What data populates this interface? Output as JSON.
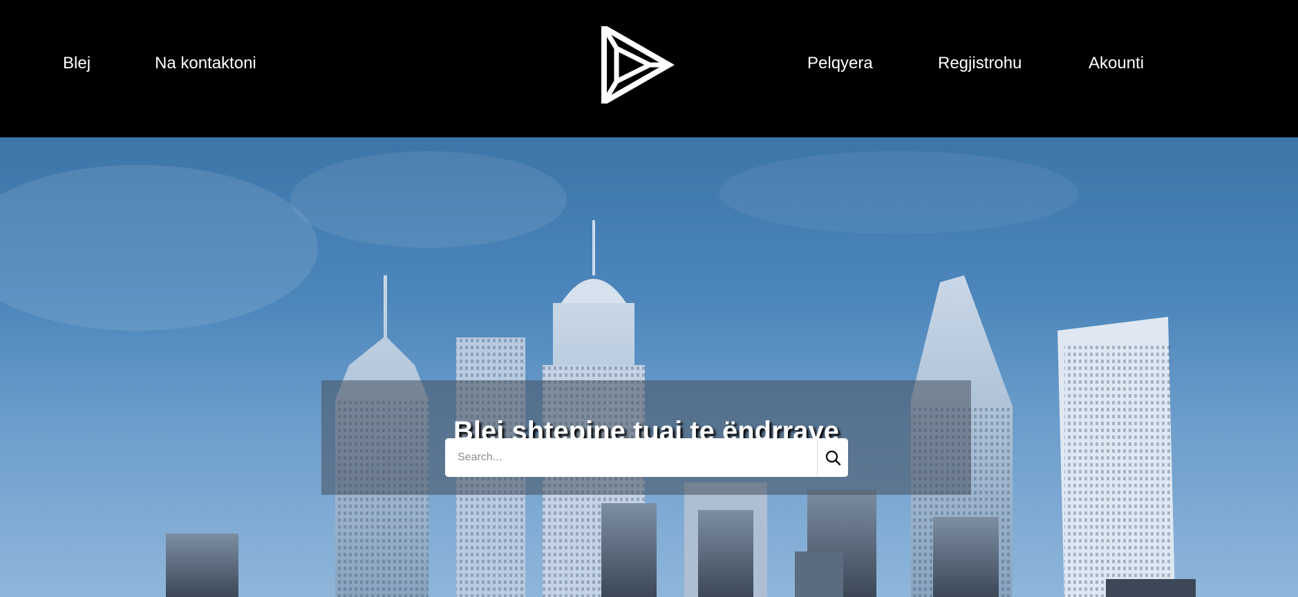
{
  "nav": {
    "left": [
      "Blej",
      "Na kontaktoni"
    ],
    "right": [
      "Pelqyera",
      "Regjistrohu",
      "Akounti"
    ],
    "logo_icon": "triangle-play-logo"
  },
  "hero": {
    "title": "Blej shtepine tuaj te ëndrrave",
    "search": {
      "placeholder": "Search...",
      "value": "",
      "icon": "search-icon"
    }
  },
  "colors": {
    "nav_bg": "#000000",
    "nav_text": "#ffffff",
    "panel_bg": "rgba(70,80,95,0.55)",
    "sky_top": "#3d75a8",
    "sky_bottom": "#8fb6da"
  }
}
